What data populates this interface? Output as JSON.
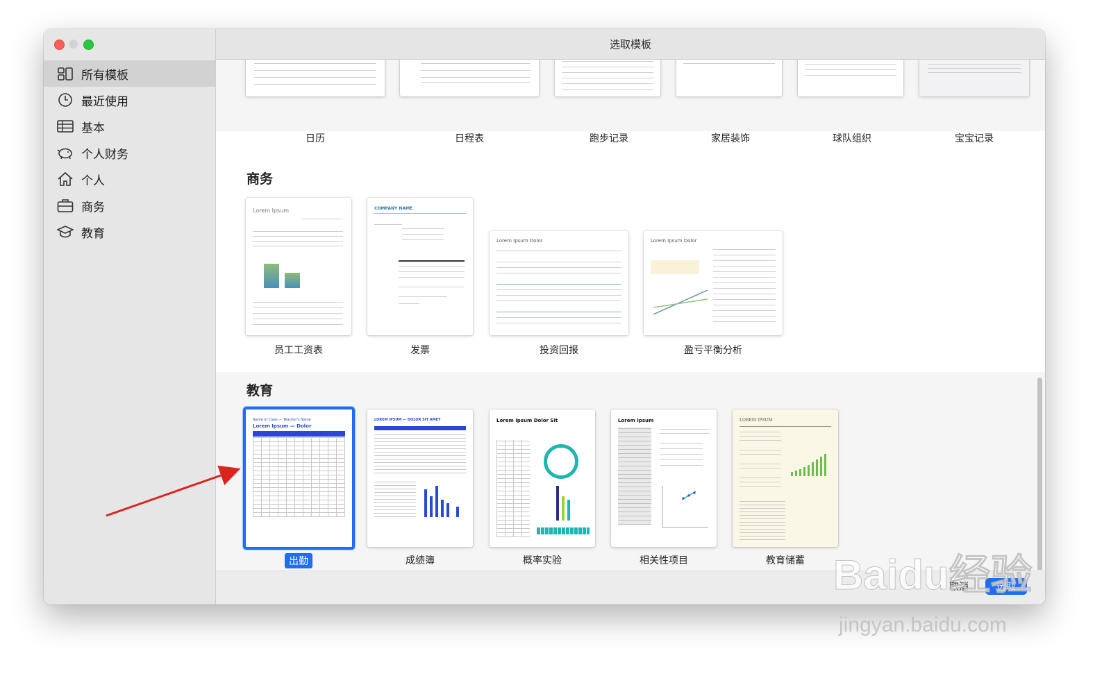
{
  "window": {
    "title": "选取模板"
  },
  "sidebar": {
    "items": [
      {
        "label": "所有模板",
        "icon": "grid-icon"
      },
      {
        "label": "最近使用",
        "icon": "clock-icon"
      },
      {
        "label": "基本",
        "icon": "table-icon"
      },
      {
        "label": "个人财务",
        "icon": "piggy-bank-icon"
      },
      {
        "label": "个人",
        "icon": "house-icon"
      },
      {
        "label": "商务",
        "icon": "briefcase-icon"
      },
      {
        "label": "教育",
        "icon": "graduation-cap-icon"
      }
    ]
  },
  "top_row": {
    "templates": [
      "日历",
      "日程表",
      "跑步记录",
      "家居装饰",
      "球队组织",
      "宝宝记录"
    ]
  },
  "business": {
    "title": "商务",
    "templates": [
      "员工工资表",
      "发票",
      "投资回报",
      "盈亏平衡分析"
    ]
  },
  "education": {
    "title": "教育",
    "templates": [
      "出勤",
      "成绩簿",
      "概率实验",
      "相关性项目",
      "教育储蓄"
    ],
    "selected": "出勤"
  },
  "thumb_text": {
    "payroll_title": "Lorem Ipsum",
    "invoice_title": "COMPANY NAME",
    "roi_title": "Lorem Ipsum Dolor",
    "breakeven_title": "Lorem Ipsum Dolor",
    "attendance_sub": "Name of Class — Teacher's Name",
    "attendance_title": "Lorem Ipsum — Dolor",
    "gradebook_title": "LOREM IPSUM — DOLOR SIT AMET",
    "probability_title": "Lorem Ipsum Dolor Sit",
    "correlation_title": "Lorem Ipsum",
    "savings_title": "LOREM IPSUM"
  },
  "footer": {
    "cancel": "取消",
    "choose": "选取"
  },
  "watermark": {
    "brand": "Baidu经验",
    "url": "jingyan.baidu.com"
  },
  "colors": {
    "accent": "#1e6ef5",
    "annotation_arrow": "#d9251d"
  }
}
